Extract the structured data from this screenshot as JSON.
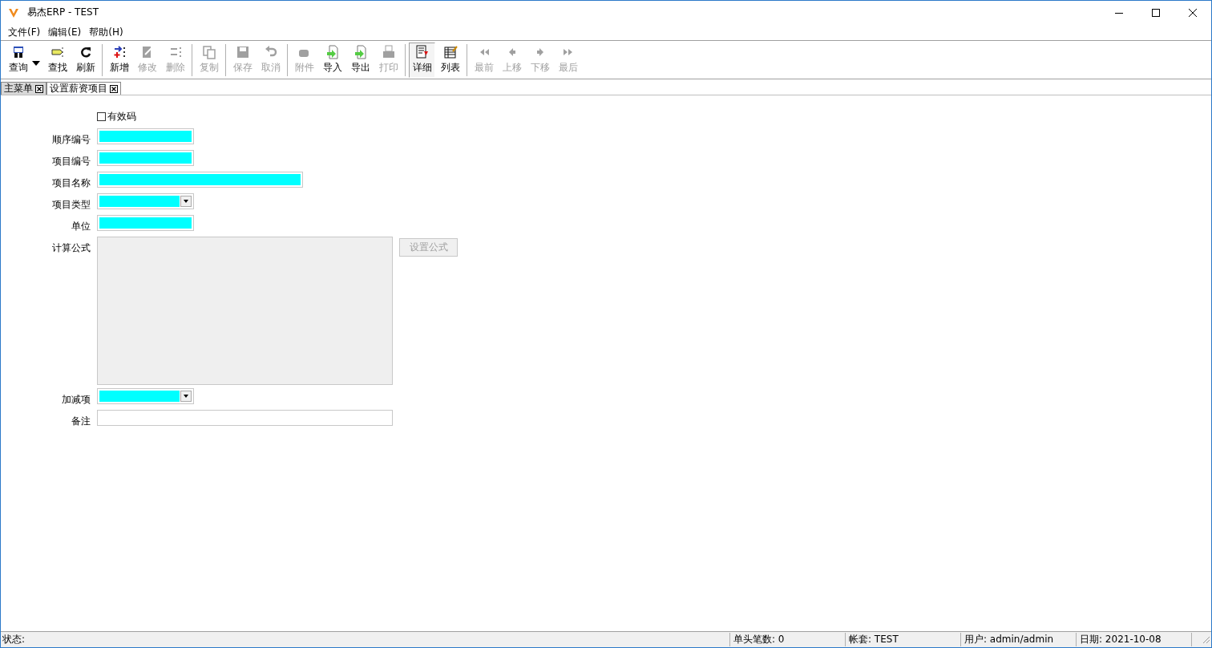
{
  "window": {
    "title": "易杰ERP - TEST"
  },
  "menu": [
    {
      "label": "文件(F)"
    },
    {
      "label": "编辑(E)"
    },
    {
      "label": "帮助(H)"
    }
  ],
  "toolbar": [
    [
      {
        "label": "查询",
        "kind": "query",
        "disabled": false,
        "selected": false
      },
      {
        "label": "查找",
        "kind": "find",
        "disabled": false,
        "selected": false
      },
      {
        "label": "刷新",
        "kind": "refresh",
        "disabled": false,
        "selected": false
      }
    ],
    [
      {
        "label": "新增",
        "kind": "add",
        "disabled": false,
        "selected": false
      },
      {
        "label": "修改",
        "kind": "edit",
        "disabled": true,
        "selected": false
      },
      {
        "label": "删除",
        "kind": "delete",
        "disabled": true,
        "selected": false
      }
    ],
    [
      {
        "label": "复制",
        "kind": "copy",
        "disabled": true,
        "selected": false
      }
    ],
    [
      {
        "label": "保存",
        "kind": "save",
        "disabled": true,
        "selected": false
      },
      {
        "label": "取消",
        "kind": "undo",
        "disabled": true,
        "selected": false
      }
    ],
    [
      {
        "label": "附件",
        "kind": "attach",
        "disabled": true,
        "selected": false
      },
      {
        "label": "导入",
        "kind": "import",
        "disabled": false,
        "selected": false
      },
      {
        "label": "导出",
        "kind": "export",
        "disabled": false,
        "selected": false
      },
      {
        "label": "打印",
        "kind": "print",
        "disabled": true,
        "selected": false
      }
    ],
    [
      {
        "label": "详细",
        "kind": "detail",
        "disabled": false,
        "selected": true
      },
      {
        "label": "列表",
        "kind": "list",
        "disabled": false,
        "selected": false
      }
    ],
    [
      {
        "label": "最前",
        "kind": "first",
        "disabled": true,
        "selected": false
      },
      {
        "label": "上移",
        "kind": "prev",
        "disabled": true,
        "selected": false
      },
      {
        "label": "下移",
        "kind": "next",
        "disabled": true,
        "selected": false
      },
      {
        "label": "最后",
        "kind": "last",
        "disabled": true,
        "selected": false
      }
    ]
  ],
  "tabs": [
    {
      "label": "主菜单",
      "selected": false
    },
    {
      "label": "设置薪资项目",
      "selected": true
    }
  ],
  "form": {
    "fields": [
      {
        "kind": "checkbox",
        "label": "有效码",
        "checked": false
      },
      {
        "kind": "text",
        "label": "顺序编号",
        "required": true,
        "wide": false
      },
      {
        "kind": "text",
        "label": "项目编号",
        "required": true,
        "wide": false
      },
      {
        "kind": "text",
        "label": "项目名称",
        "required": true,
        "wide": true
      },
      {
        "kind": "combo",
        "label": "项目类型",
        "required": true
      },
      {
        "kind": "text",
        "label": "单位",
        "required": true,
        "wide": false
      },
      {
        "kind": "textarea",
        "label": "计算公式",
        "disabled": true,
        "button": {
          "label": "设置公式",
          "disabled": true
        }
      },
      {
        "kind": "combo",
        "label": "加减项",
        "required": true
      },
      {
        "kind": "memo",
        "label": "备注",
        "required": false
      }
    ]
  },
  "status_bar": [
    {
      "label": "状态:"
    },
    {
      "label": "单头笔数: 0"
    },
    {
      "label": "帐套: TEST"
    },
    {
      "label": "用户: admin/admin"
    },
    {
      "label": "日期: 2021-10-08"
    }
  ]
}
